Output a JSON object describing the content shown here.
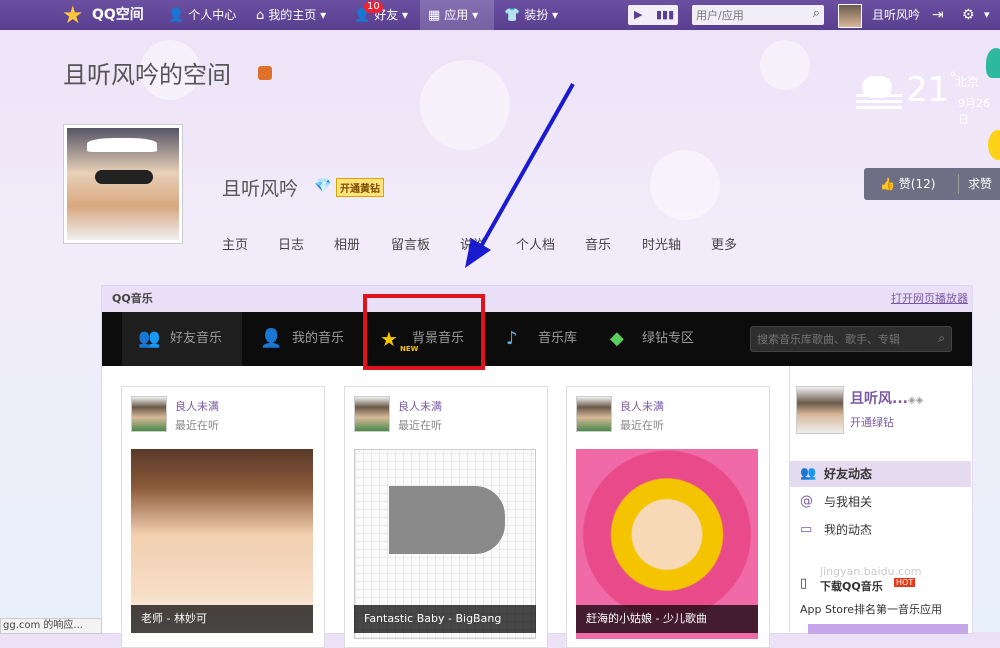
{
  "topbar": {
    "brand": "QQ空间",
    "personal_center": "个人中心",
    "my_homepage": "我的主页",
    "friends": "好友",
    "friends_badge": "10",
    "apps": "应用",
    "dressup": "装扮",
    "search_placeholder": "用户/应用",
    "user_name": "且听风吟"
  },
  "header": {
    "space_title": "且听风吟的空间",
    "nickname": "且听风吟",
    "open_yellow_diamond": "开通黄钻",
    "nav": [
      "主页",
      "日志",
      "相册",
      "留言板",
      "说说",
      "个人档",
      "音乐",
      "时光轴",
      "更多"
    ]
  },
  "weather": {
    "temp": "21",
    "degree": "°",
    "city": "北京",
    "date": "9月26日"
  },
  "likebar": {
    "like_label": "赞(12)",
    "ask_label": "求赞"
  },
  "music": {
    "panel_title": "QQ音乐",
    "open_player": "打开网页播放器",
    "tabs": [
      "好友音乐",
      "我的音乐",
      "背景音乐",
      "音乐库",
      "绿钻专区"
    ],
    "new_tag": "NEW",
    "search_placeholder": "搜索音乐库歌曲、歌手、专辑",
    "cards": [
      {
        "user": "良人未满",
        "status": "最近在听",
        "song": "老师 - 林妙可"
      },
      {
        "user": "良人未满",
        "status": "最近在听",
        "song": "Fantastic Baby - BigBang"
      },
      {
        "user": "良人未满",
        "status": "最近在听",
        "song": "赶海的小姑娘 - 少儿歌曲"
      }
    ]
  },
  "sidebar": {
    "name": "且听风...",
    "open_green": "开通绿钻",
    "items": [
      "好友动态",
      "与我相关",
      "我的动态"
    ],
    "download_title": "下载QQ音乐",
    "hot_tag": "HOT",
    "download_sub": "App Store排名第一音乐应用"
  },
  "status_bar": {
    "text": "gg.com 的响应..."
  },
  "watermark": {
    "text": "Bai 经验",
    "sub": "jingyan.baidu.com"
  },
  "colors": {
    "topbar": "#5a3f90",
    "accent": "#7a5aa6",
    "highlight_box": "#e0121c",
    "music_tabs_bg": "#0c0c0c"
  }
}
